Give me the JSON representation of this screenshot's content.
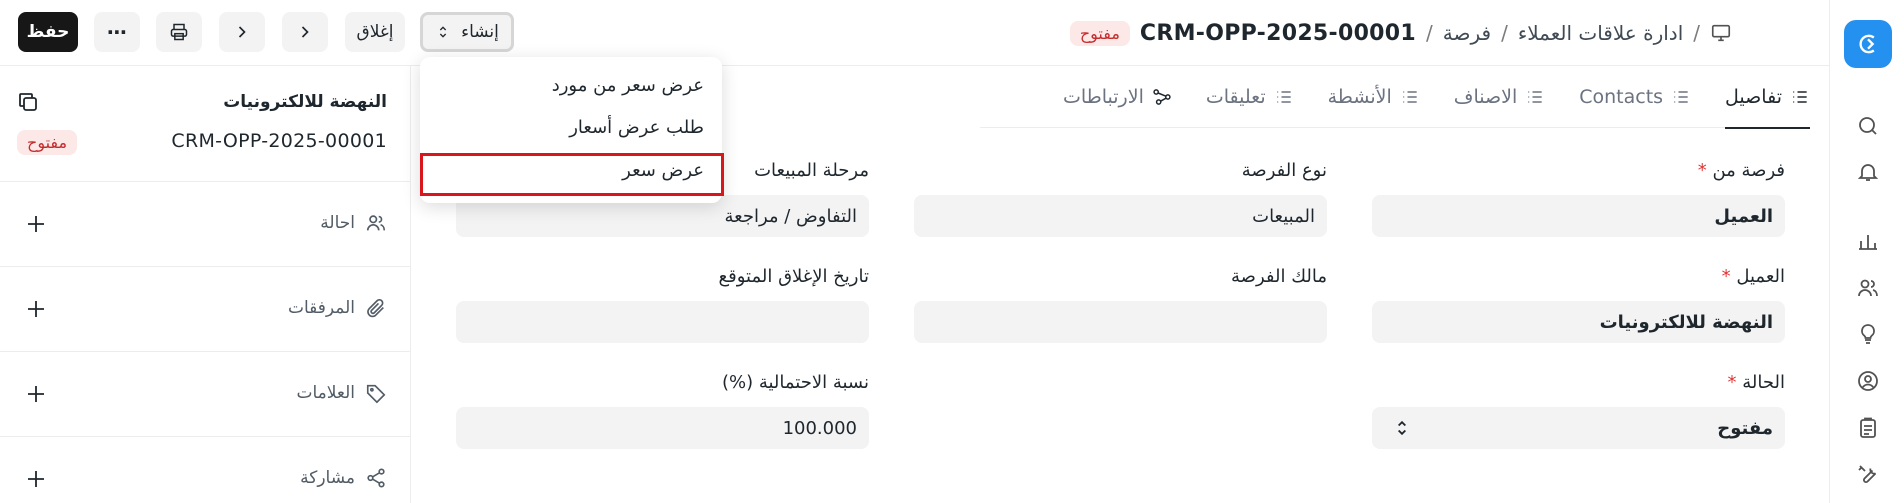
{
  "header": {
    "breadcrumbs": [
      "ادارة علاقات العملاء",
      "فرصة"
    ],
    "title": "CRM-OPP-2025-00001",
    "status_badge": "مفتوح",
    "actions": {
      "save_label": "حفظ",
      "more_label": "⋯",
      "close_label": "إغلاق",
      "create_label": "إنشاء"
    }
  },
  "create_menu": {
    "items": [
      "عرض سعر من مورد",
      "طلب عرض أسعار",
      "عرض سعر"
    ]
  },
  "tabs": [
    "تفاصيل",
    "Contacts",
    "الاصناف",
    "الأنشطة",
    "تعليقات",
    "الارتباطات"
  ],
  "form": {
    "opportunity_from": {
      "label": "فرصة من",
      "value": "العميل"
    },
    "opportunity_type": {
      "label": "نوع الفرصة",
      "value": "المبيعات"
    },
    "sales_stage": {
      "label": "مرحلة المبيعات",
      "value": "التفاوض / مراجعة"
    },
    "customer": {
      "label": "العميل",
      "value": "النهضة للالكترونيات"
    },
    "opportunity_owner": {
      "label": "مالك الفرصة",
      "value": ""
    },
    "expected_closing": {
      "label": "تاريخ الإغلاق المتوقع",
      "value": ""
    },
    "status": {
      "label": "الحالة",
      "value": "مفتوح"
    },
    "probability": {
      "label": "نسبة الاحتمالية (%)",
      "value": "100.000"
    }
  },
  "sidebar": {
    "name": "النهضة للالكترونيات",
    "id": "CRM-OPP-2025-00001",
    "status": "مفتوح",
    "rows": [
      "احالة",
      "المرفقات",
      "العلامات",
      "مشاركة"
    ]
  },
  "colors": {
    "accent": "#2490ef",
    "danger": "#c32d2d",
    "highlight": "#d9161c"
  }
}
